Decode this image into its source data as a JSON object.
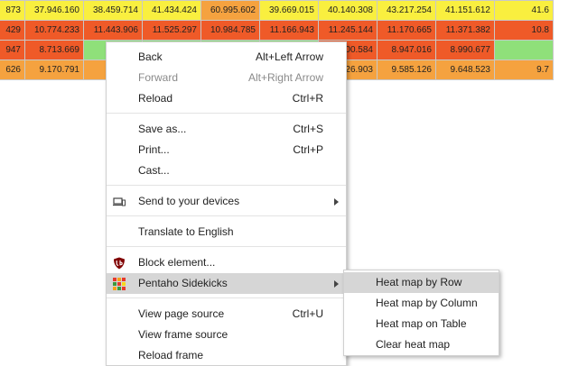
{
  "heatmap": {
    "rows": [
      {
        "cells": [
          {
            "value": "873",
            "color": "#f9ef3f"
          },
          {
            "value": "37.946.160",
            "color": "#f9ef3f"
          },
          {
            "value": "38.459.714",
            "color": "#f9ef3f"
          },
          {
            "value": "41.434.424",
            "color": "#f9ef3f"
          },
          {
            "value": "60.995.602",
            "color": "#f5a23f"
          },
          {
            "value": "39.669.015",
            "color": "#f9ef3f"
          },
          {
            "value": "40.140.308",
            "color": "#f9ef3f"
          },
          {
            "value": "43.217.254",
            "color": "#f9ef3f"
          },
          {
            "value": "41.151.612",
            "color": "#f9ef3f"
          },
          {
            "value": "41.6",
            "color": "#f9ef3f"
          }
        ]
      },
      {
        "cells": [
          {
            "value": "429",
            "color": "#ef5a28"
          },
          {
            "value": "10.774.233",
            "color": "#ef5a28"
          },
          {
            "value": "11.443.906",
            "color": "#ef5a28"
          },
          {
            "value": "11.525.297",
            "color": "#ef5a28"
          },
          {
            "value": "10.984.785",
            "color": "#ef5a28"
          },
          {
            "value": "11.166.943",
            "color": "#ef5a28"
          },
          {
            "value": "11.245.144",
            "color": "#ef5a28"
          },
          {
            "value": "11.170.665",
            "color": "#ef5a28"
          },
          {
            "value": "11.371.382",
            "color": "#ef5a28"
          },
          {
            "value": "10.8",
            "color": "#ef5a28"
          }
        ]
      },
      {
        "cells": [
          {
            "value": "947",
            "color": "#ef5a28"
          },
          {
            "value": "8.713.669",
            "color": "#ef5a28"
          },
          {
            "value": "",
            "color": "#8fe07a"
          },
          {
            "value": "",
            "color": "#8fe07a"
          },
          {
            "value": "",
            "color": "#8fe07a"
          },
          {
            "value": "",
            "color": "#8fe07a"
          },
          {
            "value": "900.584",
            "color": "#ef5a28"
          },
          {
            "value": "8.947.016",
            "color": "#ef5a28"
          },
          {
            "value": "8.990.677",
            "color": "#ef5a28"
          },
          {
            "value": "",
            "color": "#8fe07a"
          }
        ]
      },
      {
        "cells": [
          {
            "value": "626",
            "color": "#f5a23f"
          },
          {
            "value": "9.170.791",
            "color": "#f5a23f"
          },
          {
            "value": "9.",
            "color": "#f5a23f"
          },
          {
            "value": "",
            "color": "#f5a23f"
          },
          {
            "value": "",
            "color": "#f5a23f"
          },
          {
            "value": "",
            "color": "#f5a23f"
          },
          {
            "value": "526.903",
            "color": "#f5a23f"
          },
          {
            "value": "9.585.126",
            "color": "#f5a23f"
          },
          {
            "value": "9.648.523",
            "color": "#f5a23f"
          },
          {
            "value": "9.7",
            "color": "#f5a23f"
          }
        ]
      }
    ]
  },
  "context_menu": {
    "back": {
      "label": "Back",
      "shortcut": "Alt+Left Arrow"
    },
    "forward": {
      "label": "Forward",
      "shortcut": "Alt+Right Arrow"
    },
    "reload": {
      "label": "Reload",
      "shortcut": "Ctrl+R"
    },
    "save_as": {
      "label": "Save as...",
      "shortcut": "Ctrl+S"
    },
    "print": {
      "label": "Print...",
      "shortcut": "Ctrl+P"
    },
    "cast": {
      "label": "Cast..."
    },
    "send_to_devices": {
      "label": "Send to your devices",
      "icon": "devices-icon"
    },
    "translate": {
      "label": "Translate to English"
    },
    "block_element": {
      "label": "Block element...",
      "icon": "ublock-shield-icon"
    },
    "pentaho_sidekicks": {
      "label": "Pentaho Sidekicks",
      "icon": "pentaho-grid-icon"
    },
    "view_page_source": {
      "label": "View page source",
      "shortcut": "Ctrl+U"
    },
    "view_frame_source": {
      "label": "View frame source"
    },
    "reload_frame": {
      "label": "Reload frame"
    }
  },
  "submenu": {
    "heat_map_by_row": "Heat map by Row",
    "heat_map_by_column": "Heat map by Column",
    "heat_map_on_table": "Heat map on Table",
    "clear_heat_map": "Clear heat map"
  },
  "colors": {
    "yellow": "#f9ef3f",
    "red_orange": "#ef5a28",
    "orange": "#f5a23f",
    "green": "#8fe07a",
    "menu_highlight": "#d6d6d6",
    "ublock_red": "#800000"
  }
}
